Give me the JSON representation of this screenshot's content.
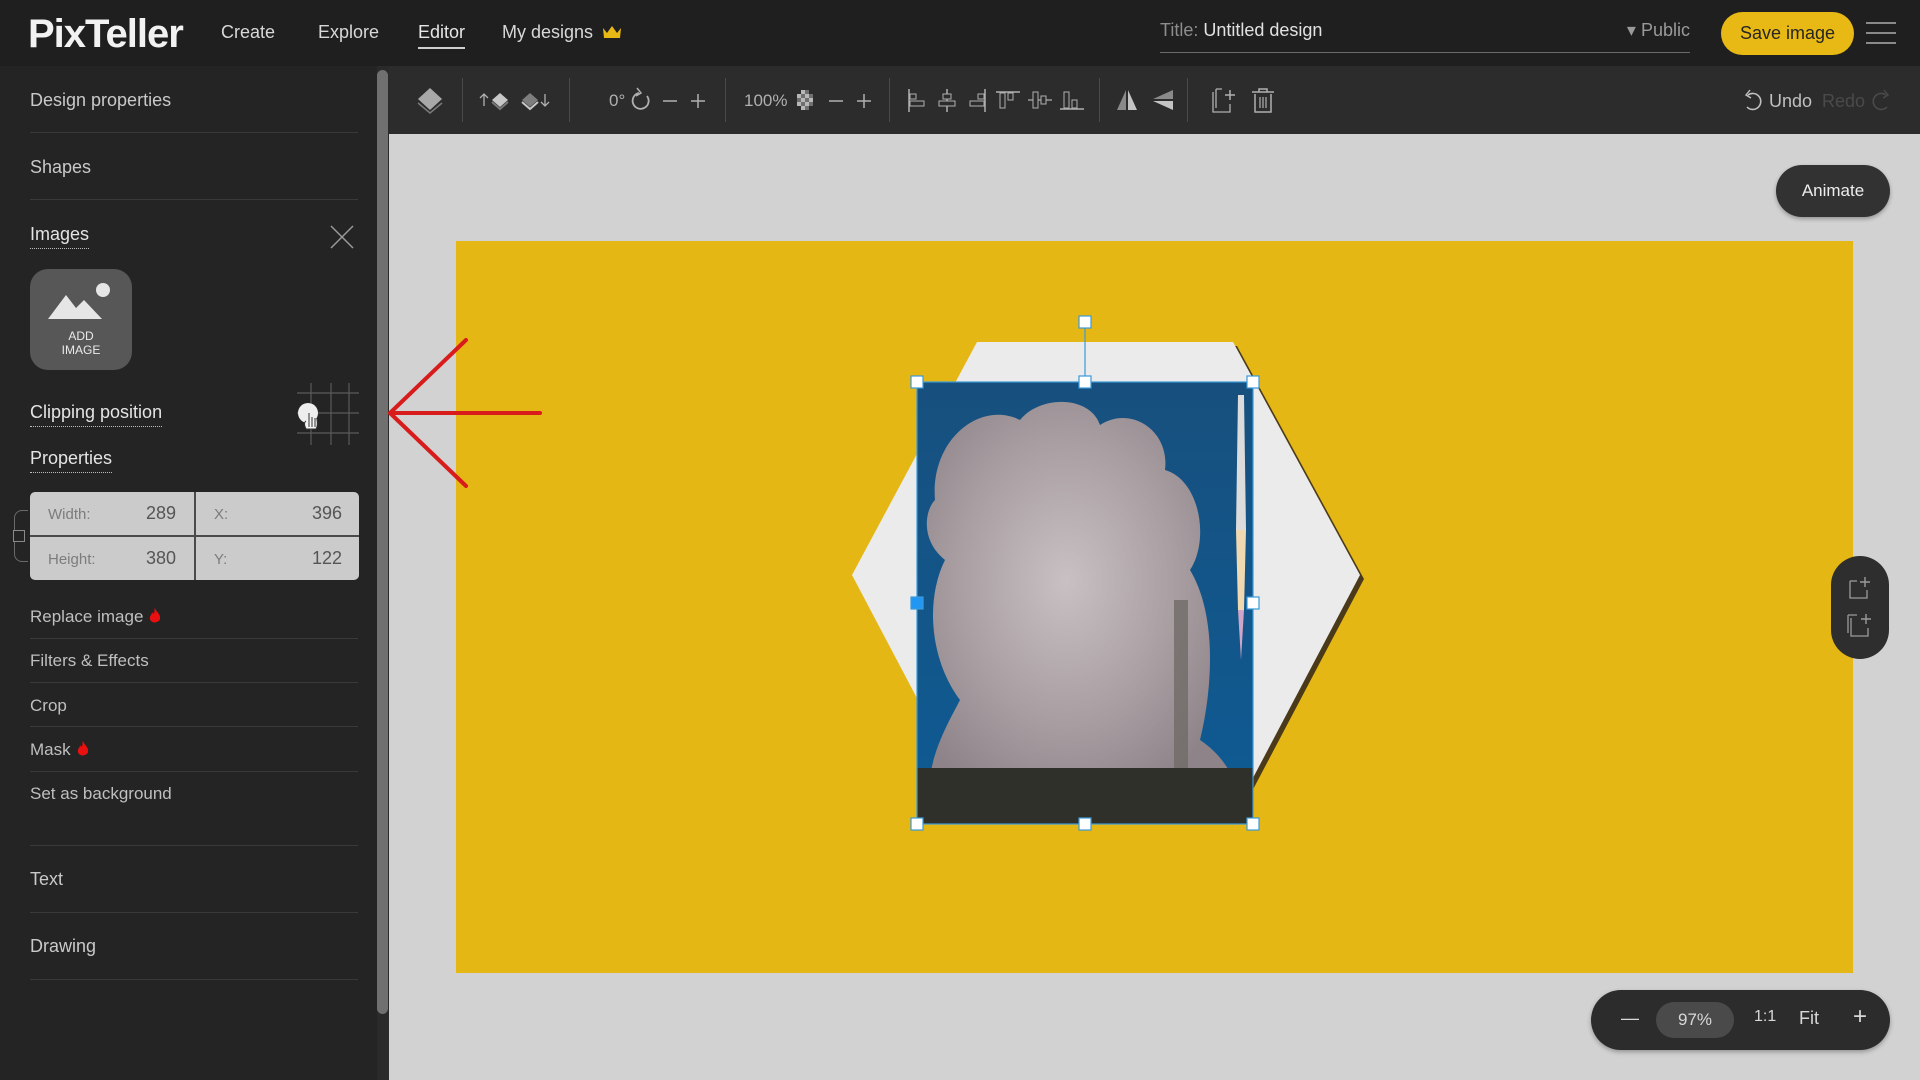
{
  "app": {
    "logo": "PixTeller"
  },
  "nav": {
    "items": [
      {
        "label": "Create"
      },
      {
        "label": "Explore"
      },
      {
        "label": "Editor",
        "active": true
      },
      {
        "label": "My designs",
        "icon": "crown-icon"
      }
    ]
  },
  "title": {
    "label": "Title:",
    "value": "Untitled design",
    "visibility": "Public"
  },
  "save_label": "Save image",
  "colors": {
    "accent": "#e8b814",
    "canvas": "#e5b714",
    "selection": "#2196f3",
    "arrow": "#d81b1b",
    "flame": "#e81010"
  },
  "toolbar": {
    "rotation": "0°",
    "opacity": "100%",
    "undo": "Undo",
    "redo": "Redo"
  },
  "sidebar": {
    "sections": {
      "design_properties": "Design properties",
      "shapes": "Shapes",
      "images": "Images",
      "add_image_line1": "ADD",
      "add_image_line2": "IMAGE",
      "clipping_position": "Clipping position",
      "properties": "Properties",
      "text": "Text",
      "drawing": "Drawing"
    },
    "props": {
      "width_label": "Width:",
      "width": "289",
      "height_label": "Height:",
      "height": "380",
      "x_label": "X:",
      "x": "396",
      "y_label": "Y:",
      "y": "122"
    },
    "menu": [
      {
        "label": "Replace image",
        "hot": true
      },
      {
        "label": "Filters & Effects"
      },
      {
        "label": "Crop"
      },
      {
        "label": "Mask",
        "hot": true
      },
      {
        "label": "Set as background"
      }
    ]
  },
  "canvas": {
    "animate": "Animate"
  },
  "zoom": {
    "minus": "—",
    "value": "97%",
    "one_to_one": "1:1",
    "fit": "Fit",
    "plus": "+"
  }
}
